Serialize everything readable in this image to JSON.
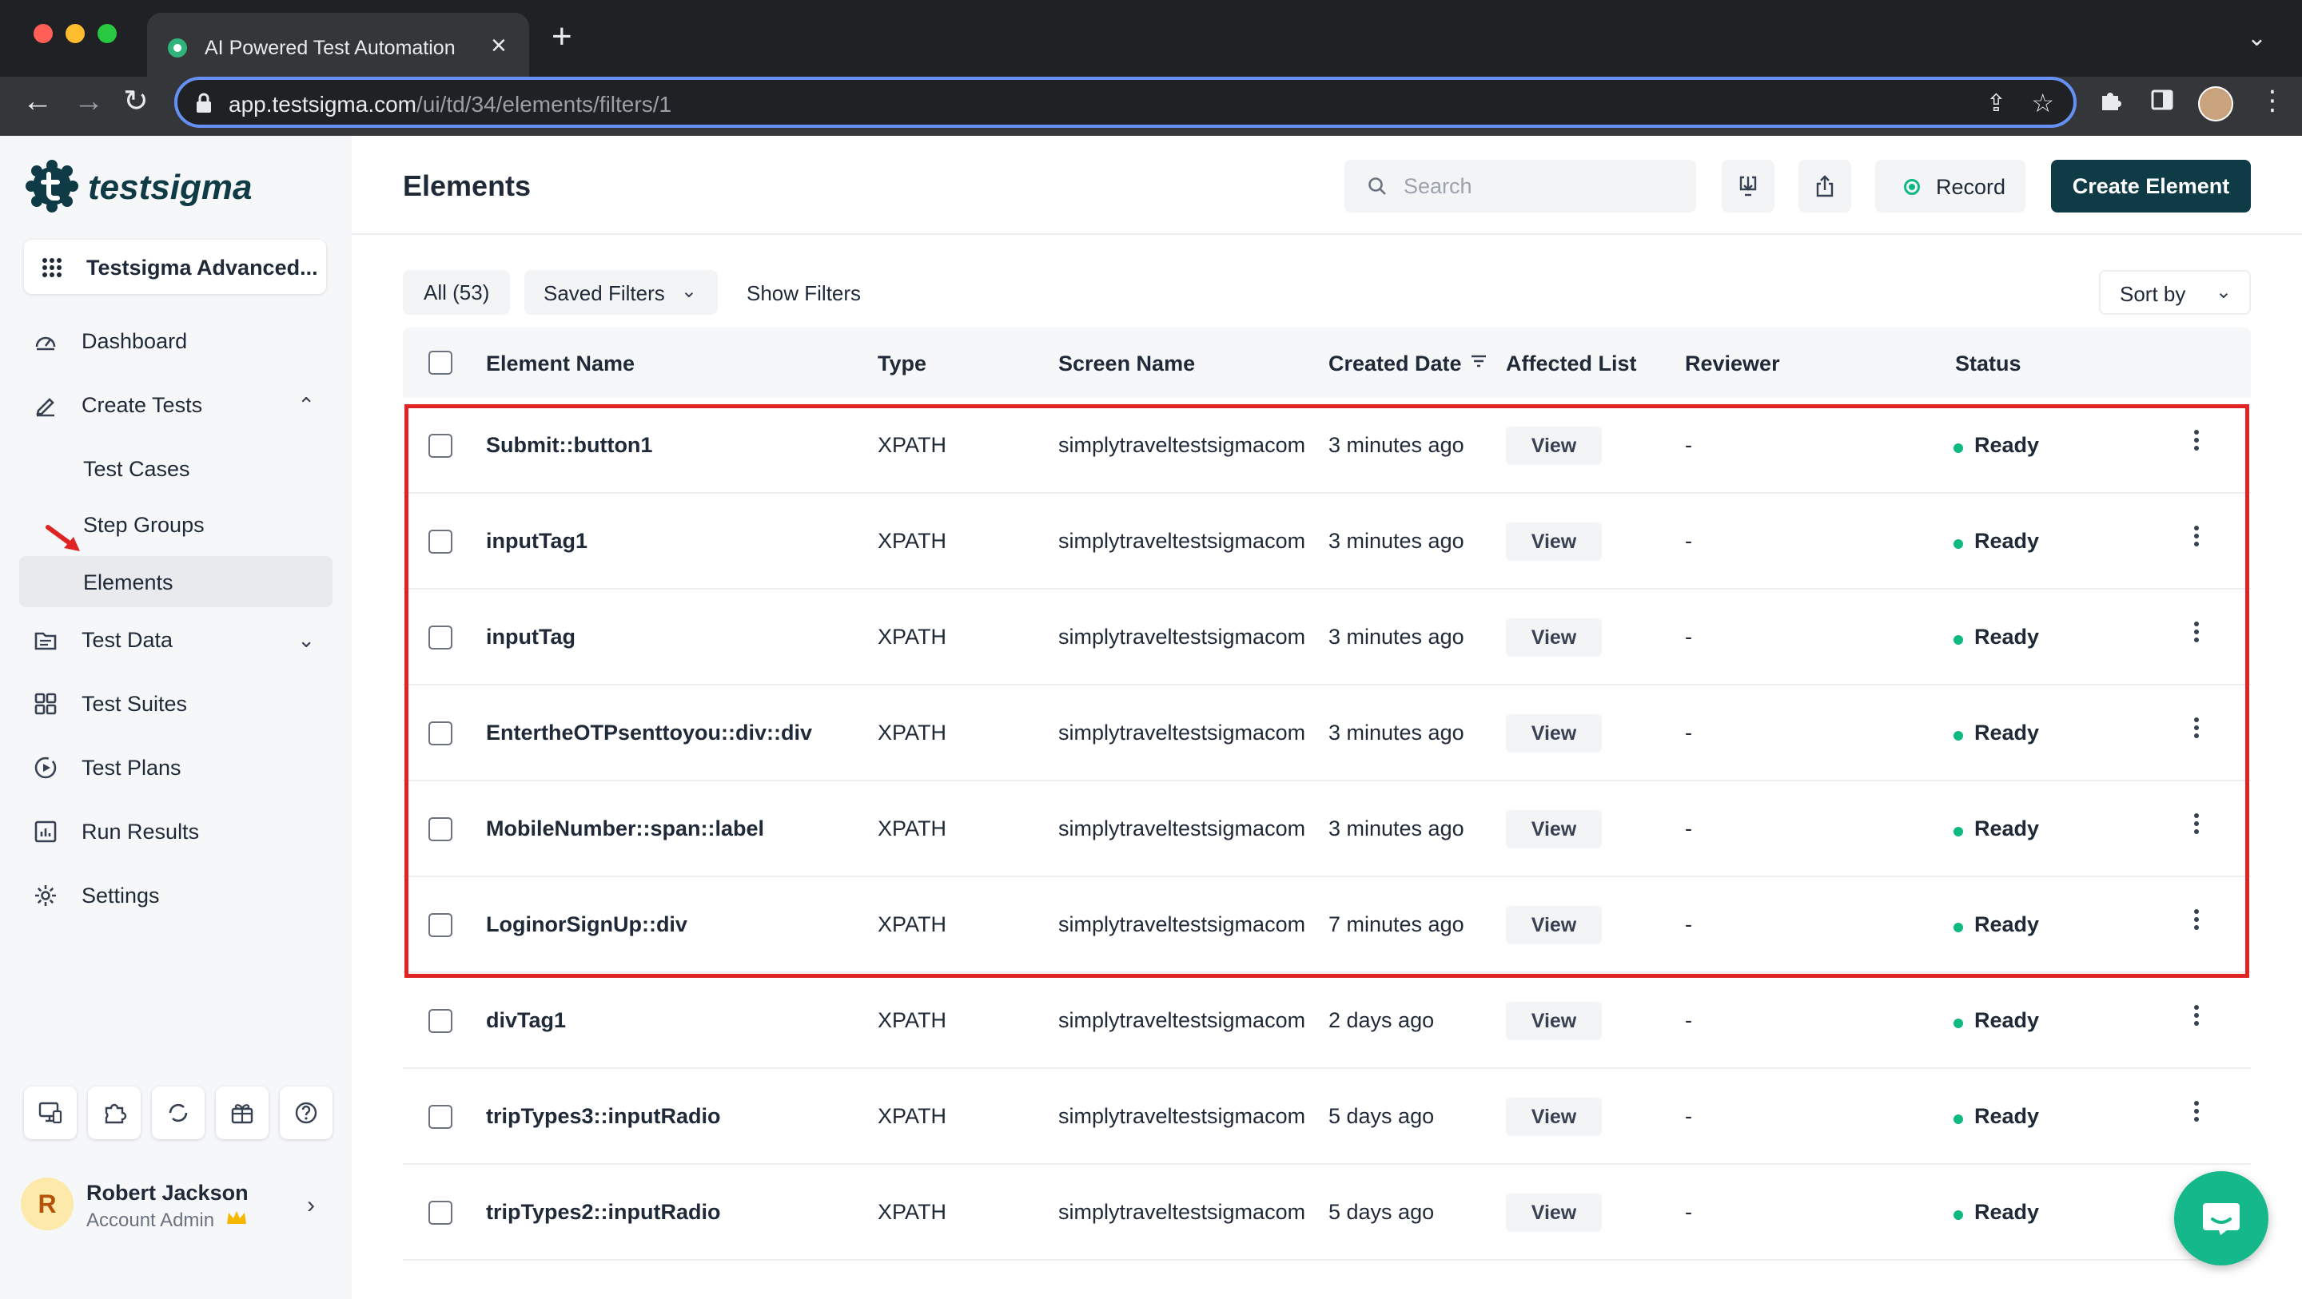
{
  "browser": {
    "tab_title": "AI Powered Test Automation P",
    "url_host": "app.testsigma.com",
    "url_path": "/ui/td/34/elements/filters/1"
  },
  "sidebar": {
    "logo_text": "testsigma",
    "project_name": "Testsigma Advanced...",
    "nav": {
      "dashboard": "Dashboard",
      "create_tests": "Create Tests",
      "test_cases": "Test Cases",
      "step_groups": "Step Groups",
      "elements": "Elements",
      "test_data": "Test Data",
      "test_suites": "Test Suites",
      "test_plans": "Test Plans",
      "run_results": "Run Results",
      "settings": "Settings"
    },
    "user": {
      "initial": "R",
      "name": "Robert Jackson",
      "role": "Account Admin"
    }
  },
  "header": {
    "title": "Elements",
    "search_placeholder": "Search",
    "record_label": "Record",
    "create_label": "Create Element"
  },
  "filters": {
    "all_label": "All (53)",
    "saved_filters": "Saved Filters",
    "show_filters": "Show Filters",
    "sort_by": "Sort by"
  },
  "table": {
    "columns": {
      "name": "Element Name",
      "type": "Type",
      "screen": "Screen Name",
      "created": "Created Date",
      "affected": "Affected List",
      "reviewer": "Reviewer",
      "status": "Status"
    },
    "view_label": "View",
    "rows": [
      {
        "name": "Submit::button1",
        "type": "XPATH",
        "screen": "simplytraveltestsigmacom",
        "created": "3 minutes ago",
        "reviewer": "-",
        "status": "Ready"
      },
      {
        "name": "inputTag1",
        "type": "XPATH",
        "screen": "simplytraveltestsigmacom",
        "created": "3 minutes ago",
        "reviewer": "-",
        "status": "Ready"
      },
      {
        "name": "inputTag",
        "type": "XPATH",
        "screen": "simplytraveltestsigmacom",
        "created": "3 minutes ago",
        "reviewer": "-",
        "status": "Ready"
      },
      {
        "name": "EntertheOTPsenttoyou::div::div",
        "type": "XPATH",
        "screen": "simplytraveltestsigmacom",
        "created": "3 minutes ago",
        "reviewer": "-",
        "status": "Ready"
      },
      {
        "name": "MobileNumber::span::label",
        "type": "XPATH",
        "screen": "simplytraveltestsigmacom",
        "created": "3 minutes ago",
        "reviewer": "-",
        "status": "Ready"
      },
      {
        "name": "LoginorSignUp::div",
        "type": "XPATH",
        "screen": "simplytraveltestsigmacom",
        "created": "7 minutes ago",
        "reviewer": "-",
        "status": "Ready"
      },
      {
        "name": "divTag1",
        "type": "XPATH",
        "screen": "simplytraveltestsigmacom",
        "created": "2 days ago",
        "reviewer": "-",
        "status": "Ready"
      },
      {
        "name": "tripTypes3::inputRadio",
        "type": "XPATH",
        "screen": "simplytraveltestsigmacom",
        "created": "5 days ago",
        "reviewer": "-",
        "status": "Ready"
      },
      {
        "name": "tripTypes2::inputRadio",
        "type": "XPATH",
        "screen": "simplytraveltestsigmacom",
        "created": "5 days ago",
        "reviewer": "-",
        "status": "Ready"
      }
    ]
  },
  "colors": {
    "brand": "#0f3b47",
    "status_ready": "#10b981",
    "highlight": "#e02424",
    "chat": "#14b88a"
  },
  "icons": [
    "search-icon",
    "import-icon",
    "export-icon",
    "record-icon",
    "dashboard-icon",
    "pencil-icon",
    "folder-icon",
    "grid-icon",
    "play-icon",
    "bar-chart-icon",
    "gear-icon",
    "chat-icon"
  ]
}
